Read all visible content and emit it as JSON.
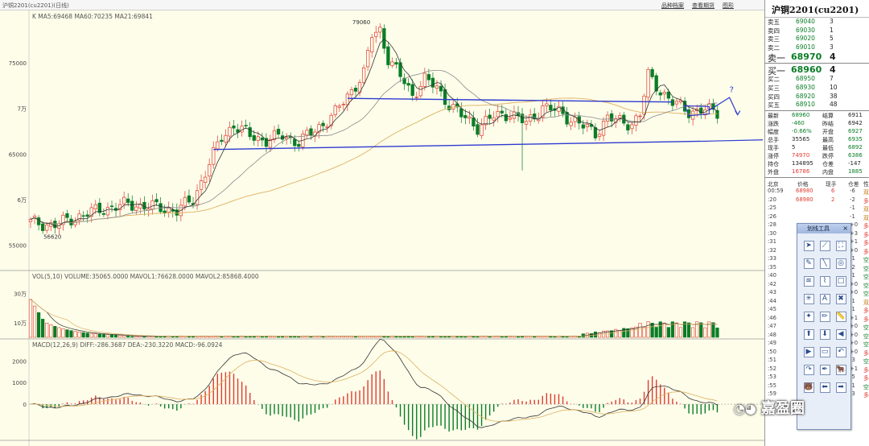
{
  "window": {
    "title": "沪铜2201(cu2201)(日线)",
    "buttons": [
      "品种档案",
      "查看期货",
      "图形"
    ]
  },
  "chart_data": [
    {
      "type": "candlestick",
      "title": "",
      "legend_text": "K  MA5:69468  MA60:70235  MA21:69841",
      "ylabels": [
        "75000",
        "7万",
        "65000",
        "6万",
        "55000"
      ],
      "ytick_values": [
        75000,
        70000,
        65000,
        60000,
        55000
      ],
      "ylim": [
        52500,
        79500
      ],
      "annotations": [
        {
          "text": "79060"
        },
        {
          "text": "56620"
        },
        {
          "text": "?"
        }
      ],
      "trendlines": [
        {
          "name": "channel-top",
          "from": {
            "i": 78,
            "v": 71100
          },
          "to": {
            "i": 158,
            "v": 70700
          }
        },
        {
          "name": "channel-bottom",
          "from": {
            "i": 45,
            "v": 65500
          },
          "to": {
            "i": 165,
            "v": 66400
          }
        }
      ]
    },
    {
      "type": "bar",
      "title": "",
      "legend_text": "VOL(5,10)  VOLUME:35065.0000  MAVOL1:76628.0000  MAVOL2:85868.4000",
      "ylabels": [
        "30万",
        "10万"
      ],
      "ytick_values": [
        300000,
        100000
      ]
    },
    {
      "type": "bar",
      "title": "",
      "legend_text": "MACD(12,26,9)  DIFF:-286.3687  DEA:-230.3220  MACD:-96.0924",
      "ylabels": [
        "2000",
        "1000",
        "0"
      ],
      "ytick_values": [
        2000,
        1000,
        0
      ]
    }
  ],
  "colors": {
    "up": "#e23b2e",
    "down": "#0a7d26",
    "ma5": "#333333",
    "ma21": "#8a8a8a",
    "ma60": "#e0b060",
    "trendline": "#2e3ad0",
    "bg": "#fdfdea"
  },
  "quote": {
    "name": "沪铜2201(cu2201)",
    "asks": [
      {
        "label": "卖五",
        "price": "69040",
        "vol": "3"
      },
      {
        "label": "卖四",
        "price": "69030",
        "vol": "1"
      },
      {
        "label": "卖三",
        "price": "69020",
        "vol": "5"
      },
      {
        "label": "卖二",
        "price": "69010",
        "vol": "3"
      },
      {
        "label": "卖一",
        "price": "68970",
        "vol": "4"
      }
    ],
    "bids": [
      {
        "label": "买一",
        "price": "68960",
        "vol": "4"
      },
      {
        "label": "买二",
        "price": "68950",
        "vol": "7"
      },
      {
        "label": "买三",
        "price": "68930",
        "vol": "10"
      },
      {
        "label": "买四",
        "price": "68920",
        "vol": "38"
      },
      {
        "label": "买五",
        "price": "68910",
        "vol": "48"
      }
    ],
    "stats": [
      {
        "l1": "最新",
        "v1": "68960",
        "l2": "结算",
        "v2": "6911"
      },
      {
        "l1": "涨跌",
        "v1": "-460",
        "l2": "昨结",
        "v2": "6942"
      },
      {
        "l1": "幅度",
        "v1": "-0.66%",
        "l2": "开盘",
        "v2": "6927"
      },
      {
        "l1": "总手",
        "v1": "35565",
        "l2": "最高",
        "v2": "6935"
      },
      {
        "l1": "现手",
        "v1": "5",
        "l2": "最低",
        "v2": "6892"
      },
      {
        "l1": "涨停",
        "v1": "74970",
        "l2": "跌停",
        "v2": "6386"
      },
      {
        "l1": "持仓",
        "v1": "134895",
        "l2": "仓差",
        "v2": "-147"
      },
      {
        "l1": "外盘",
        "v1": "16786",
        "l2": "内盘",
        "v2": "1885"
      }
    ],
    "ticks_header": {
      "place": "北京",
      "price": "价格",
      "vol": "现手",
      "oi": "仓差",
      "type": "性"
    },
    "ticks": [
      {
        "time": "00:59",
        "price": "68980",
        "vol": "6",
        "oi": "-6",
        "t": "双"
      },
      {
        "time": ":20",
        "price": "68980",
        "vol": "2",
        "oi": "-2",
        "t": "多"
      },
      {
        "time": ":25",
        "price": "",
        "vol": "",
        "oi": "-1",
        "t": "双"
      },
      {
        "time": ":26",
        "price": "",
        "vol": "",
        "oi": "-1",
        "t": "双"
      },
      {
        "time": ":28",
        "price": "",
        "vol": "",
        "oi": "+0",
        "t": "多"
      },
      {
        "time": ":30",
        "price": "",
        "vol": "",
        "oi": "+3",
        "t": "多"
      },
      {
        "time": ":31",
        "price": "",
        "vol": "",
        "oi": "+1",
        "t": "多"
      },
      {
        "time": ":32",
        "price": "",
        "vol": "",
        "oi": "+0",
        "t": "多"
      },
      {
        "time": ":33",
        "price": "",
        "vol": "",
        "oi": "-1",
        "t": "空"
      },
      {
        "time": ":35",
        "price": "",
        "vol": "",
        "oi": "-2",
        "t": "空"
      },
      {
        "time": ":40",
        "price": "",
        "vol": "",
        "oi": "-1",
        "t": "空"
      },
      {
        "time": ":42",
        "price": "",
        "vol": "",
        "oi": "+0",
        "t": "空"
      },
      {
        "time": ":43",
        "price": "",
        "vol": "",
        "oi": "+0",
        "t": "空"
      },
      {
        "time": ":44",
        "price": "",
        "vol": "",
        "oi": "-1",
        "t": "双"
      },
      {
        "time": ":45",
        "price": "",
        "vol": "",
        "oi": "-1",
        "t": "多"
      },
      {
        "time": ":46",
        "price": "",
        "vol": "",
        "oi": "+1",
        "t": "多"
      },
      {
        "time": ":47",
        "price": "",
        "vol": "",
        "oi": "+0",
        "t": "空"
      },
      {
        "time": ":48",
        "price": "",
        "vol": "",
        "oi": "+0",
        "t": "空"
      },
      {
        "time": ":49",
        "price": "",
        "vol": "",
        "oi": "+0",
        "t": "空"
      },
      {
        "time": ":50",
        "price": "",
        "vol": "",
        "oi": "+0",
        "t": "多"
      },
      {
        "time": ":51",
        "price": "",
        "vol": "",
        "oi": "-3",
        "t": "空"
      },
      {
        "time": ":52",
        "price": "",
        "vol": "",
        "oi": "+1",
        "t": "多"
      },
      {
        "time": ":53",
        "price": "",
        "vol": "",
        "oi": "-5",
        "t": "多"
      },
      {
        "time": ":55",
        "price": "",
        "vol": "",
        "oi": "-1",
        "t": "空"
      },
      {
        "time": ":59",
        "price": "",
        "vol": "",
        "oi": "-3",
        "t": "多"
      }
    ]
  },
  "drawtool": {
    "title": "划线工具",
    "close": "×",
    "icons": [
      "cursor-icon",
      "line-icon",
      "rect-select-icon",
      "brush-icon",
      "segment-icon",
      "circle-icon",
      "fib-icon",
      "lasso-icon",
      "square-icon",
      "gann-icon",
      "text-icon",
      "trash-icon",
      "star-icon",
      "pencil-icon",
      "ruler-icon",
      "arrow-up-icon",
      "arrow-down-icon",
      "arrow-left-icon",
      "arrow-right-icon",
      "rectangle-icon",
      "undo-icon",
      "redo-icon",
      "pen-icon",
      "bull-icon",
      "bear-icon",
      "back-arrow-icon",
      "forward-arrow-icon"
    ]
  },
  "watermark": {
    "text": "嘉盈圈"
  }
}
